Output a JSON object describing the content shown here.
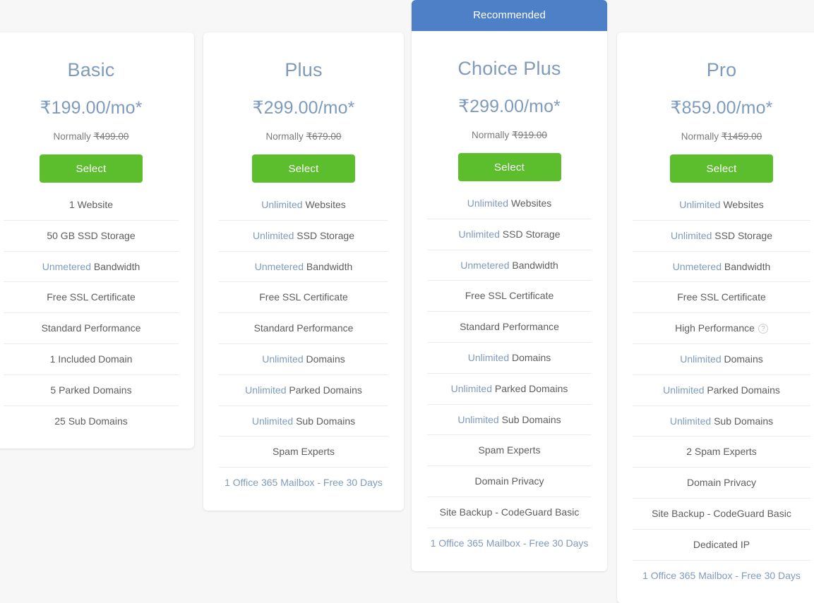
{
  "banner": {
    "recommended_label": "Recommended"
  },
  "common": {
    "select_label": "Select",
    "normally_prefix": "Normally",
    "info_icon_glyph": "?"
  },
  "colors": {
    "accent_blue": "#7e9bbd",
    "banner_blue": "#4e80c8",
    "select_green": "#5cbe2c",
    "page_background": "#f7f7f8",
    "card_background": "#ffffff",
    "divider": "#ececec",
    "body_text": "#5d5d5d"
  },
  "plans": [
    {
      "id": "basic",
      "name": "Basic",
      "price": "₹199.00/mo*",
      "normally_price": "₹499.00",
      "recommended": false,
      "features": [
        {
          "highlight": "",
          "text": "1 Website",
          "all_highlight": false,
          "info": false
        },
        {
          "highlight": "",
          "text": "50 GB SSD Storage",
          "all_highlight": false,
          "info": false
        },
        {
          "highlight": "Unmetered",
          "text": " Bandwidth",
          "all_highlight": false,
          "info": false
        },
        {
          "highlight": "",
          "text": "Free SSL Certificate",
          "all_highlight": false,
          "info": false
        },
        {
          "highlight": "",
          "text": "Standard Performance",
          "all_highlight": false,
          "info": false
        },
        {
          "highlight": "",
          "text": "1 Included Domain",
          "all_highlight": false,
          "info": false
        },
        {
          "highlight": "",
          "text": "5 Parked Domains",
          "all_highlight": false,
          "info": false
        },
        {
          "highlight": "",
          "text": "25 Sub Domains",
          "all_highlight": false,
          "info": false
        }
      ]
    },
    {
      "id": "plus",
      "name": "Plus",
      "price": "₹299.00/mo*",
      "normally_price": "₹679.00",
      "recommended": false,
      "features": [
        {
          "highlight": "Unlimited",
          "text": " Websites",
          "all_highlight": false,
          "info": false
        },
        {
          "highlight": "Unlimited",
          "text": " SSD Storage",
          "all_highlight": false,
          "info": false
        },
        {
          "highlight": "Unmetered",
          "text": " Bandwidth",
          "all_highlight": false,
          "info": false
        },
        {
          "highlight": "",
          "text": "Free SSL Certificate",
          "all_highlight": false,
          "info": false
        },
        {
          "highlight": "",
          "text": "Standard Performance",
          "all_highlight": false,
          "info": false
        },
        {
          "highlight": "Unlimited",
          "text": " Domains",
          "all_highlight": false,
          "info": false
        },
        {
          "highlight": "Unlimited",
          "text": " Parked Domains",
          "all_highlight": false,
          "info": false
        },
        {
          "highlight": "Unlimited",
          "text": " Sub Domains",
          "all_highlight": false,
          "info": false
        },
        {
          "highlight": "",
          "text": "Spam Experts",
          "all_highlight": false,
          "info": false
        },
        {
          "highlight": "",
          "text": "1 Office 365 Mailbox - Free 30 Days",
          "all_highlight": true,
          "info": false
        }
      ]
    },
    {
      "id": "choice-plus",
      "name": "Choice Plus",
      "price": "₹299.00/mo*",
      "normally_price": "₹919.00",
      "recommended": true,
      "features": [
        {
          "highlight": "Unlimited",
          "text": " Websites",
          "all_highlight": false,
          "info": false
        },
        {
          "highlight": "Unlimited",
          "text": " SSD Storage",
          "all_highlight": false,
          "info": false
        },
        {
          "highlight": "Unmetered",
          "text": " Bandwidth",
          "all_highlight": false,
          "info": false
        },
        {
          "highlight": "",
          "text": "Free SSL Certificate",
          "all_highlight": false,
          "info": false
        },
        {
          "highlight": "",
          "text": "Standard Performance",
          "all_highlight": false,
          "info": false
        },
        {
          "highlight": "Unlimited",
          "text": " Domains",
          "all_highlight": false,
          "info": false
        },
        {
          "highlight": "Unlimited",
          "text": " Parked Domains",
          "all_highlight": false,
          "info": false
        },
        {
          "highlight": "Unlimited",
          "text": " Sub Domains",
          "all_highlight": false,
          "info": false
        },
        {
          "highlight": "",
          "text": "Spam Experts",
          "all_highlight": false,
          "info": false
        },
        {
          "highlight": "",
          "text": "Domain Privacy",
          "all_highlight": false,
          "info": false
        },
        {
          "highlight": "",
          "text": "Site Backup - CodeGuard Basic",
          "all_highlight": false,
          "info": false
        },
        {
          "highlight": "",
          "text": "1 Office 365 Mailbox - Free 30 Days",
          "all_highlight": true,
          "info": false
        }
      ]
    },
    {
      "id": "pro",
      "name": "Pro",
      "price": "₹859.00/mo*",
      "normally_price": "₹1459.00",
      "recommended": false,
      "features": [
        {
          "highlight": "Unlimited",
          "text": " Websites",
          "all_highlight": false,
          "info": false
        },
        {
          "highlight": "Unlimited",
          "text": " SSD Storage",
          "all_highlight": false,
          "info": false
        },
        {
          "highlight": "Unmetered",
          "text": " Bandwidth",
          "all_highlight": false,
          "info": false
        },
        {
          "highlight": "",
          "text": "Free SSL Certificate",
          "all_highlight": false,
          "info": false
        },
        {
          "highlight": "",
          "text": "High Performance",
          "all_highlight": false,
          "info": true
        },
        {
          "highlight": "Unlimited",
          "text": " Domains",
          "all_highlight": false,
          "info": false
        },
        {
          "highlight": "Unlimited",
          "text": " Parked Domains",
          "all_highlight": false,
          "info": false
        },
        {
          "highlight": "Unlimited",
          "text": " Sub Domains",
          "all_highlight": false,
          "info": false
        },
        {
          "highlight": "",
          "text": "2 Spam Experts",
          "all_highlight": false,
          "info": false
        },
        {
          "highlight": "",
          "text": "Domain Privacy",
          "all_highlight": false,
          "info": false
        },
        {
          "highlight": "",
          "text": "Site Backup - CodeGuard Basic",
          "all_highlight": false,
          "info": false
        },
        {
          "highlight": "",
          "text": "Dedicated IP",
          "all_highlight": false,
          "info": false
        },
        {
          "highlight": "",
          "text": "1 Office 365 Mailbox - Free 30 Days",
          "all_highlight": true,
          "info": false
        }
      ]
    }
  ]
}
